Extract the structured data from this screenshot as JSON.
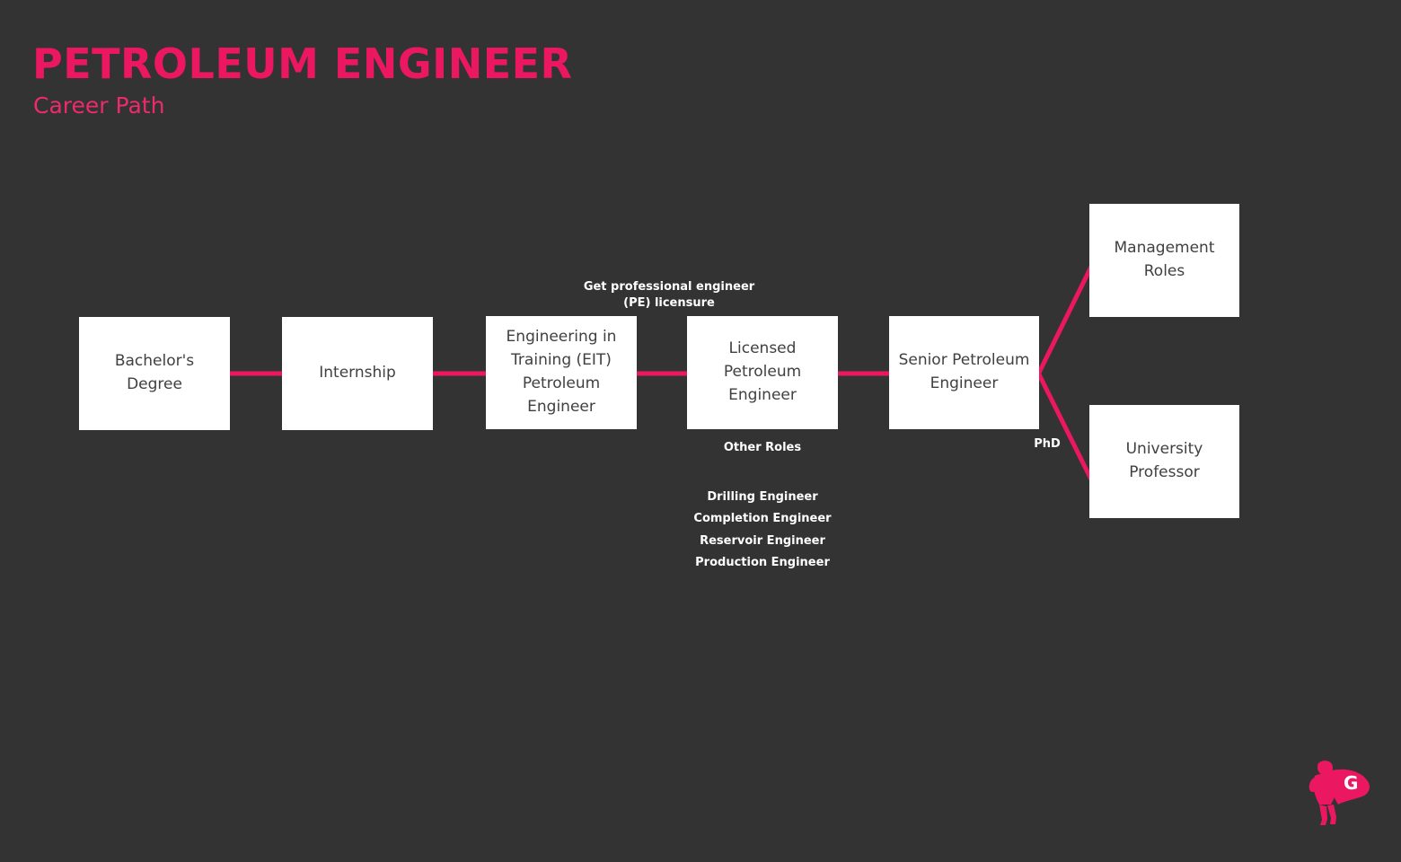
{
  "header": {
    "title": "PETROLEUM ENGINEER",
    "subtitle": "Career Path"
  },
  "colors": {
    "background": "#333333",
    "accent": "#ec1761",
    "node_fill": "#ffffff",
    "node_text": "#404040",
    "label_text": "#ffffff"
  },
  "nodes": [
    {
      "id": "bachelors-degree",
      "label": "Bachelor's\nDegree"
    },
    {
      "id": "internship",
      "label": "Internship"
    },
    {
      "id": "eit-petroleum-engineer",
      "label": "Engineering in\nTraining (EIT)\nPetroleum\nEngineer"
    },
    {
      "id": "licensed-petroleum-engineer",
      "label": "Licensed\nPetroleum\nEngineer"
    },
    {
      "id": "senior-petroleum-engineer",
      "label": "Senior Petroleum\nEngineer"
    },
    {
      "id": "management-roles",
      "label": "Management Roles"
    },
    {
      "id": "university-professor",
      "label": "University\nProfessor"
    }
  ],
  "edge_labels": {
    "pe_licensure": "Get professional engineer\n(PE) licensure",
    "phd": "PhD"
  },
  "other_roles": {
    "title": "Other Roles",
    "items": [
      "Drilling Engineer",
      "Completion Engineer",
      "Reservoir Engineer",
      "Production Engineer"
    ]
  },
  "logo": {
    "letter": "G",
    "icon": "superhero-logo"
  }
}
